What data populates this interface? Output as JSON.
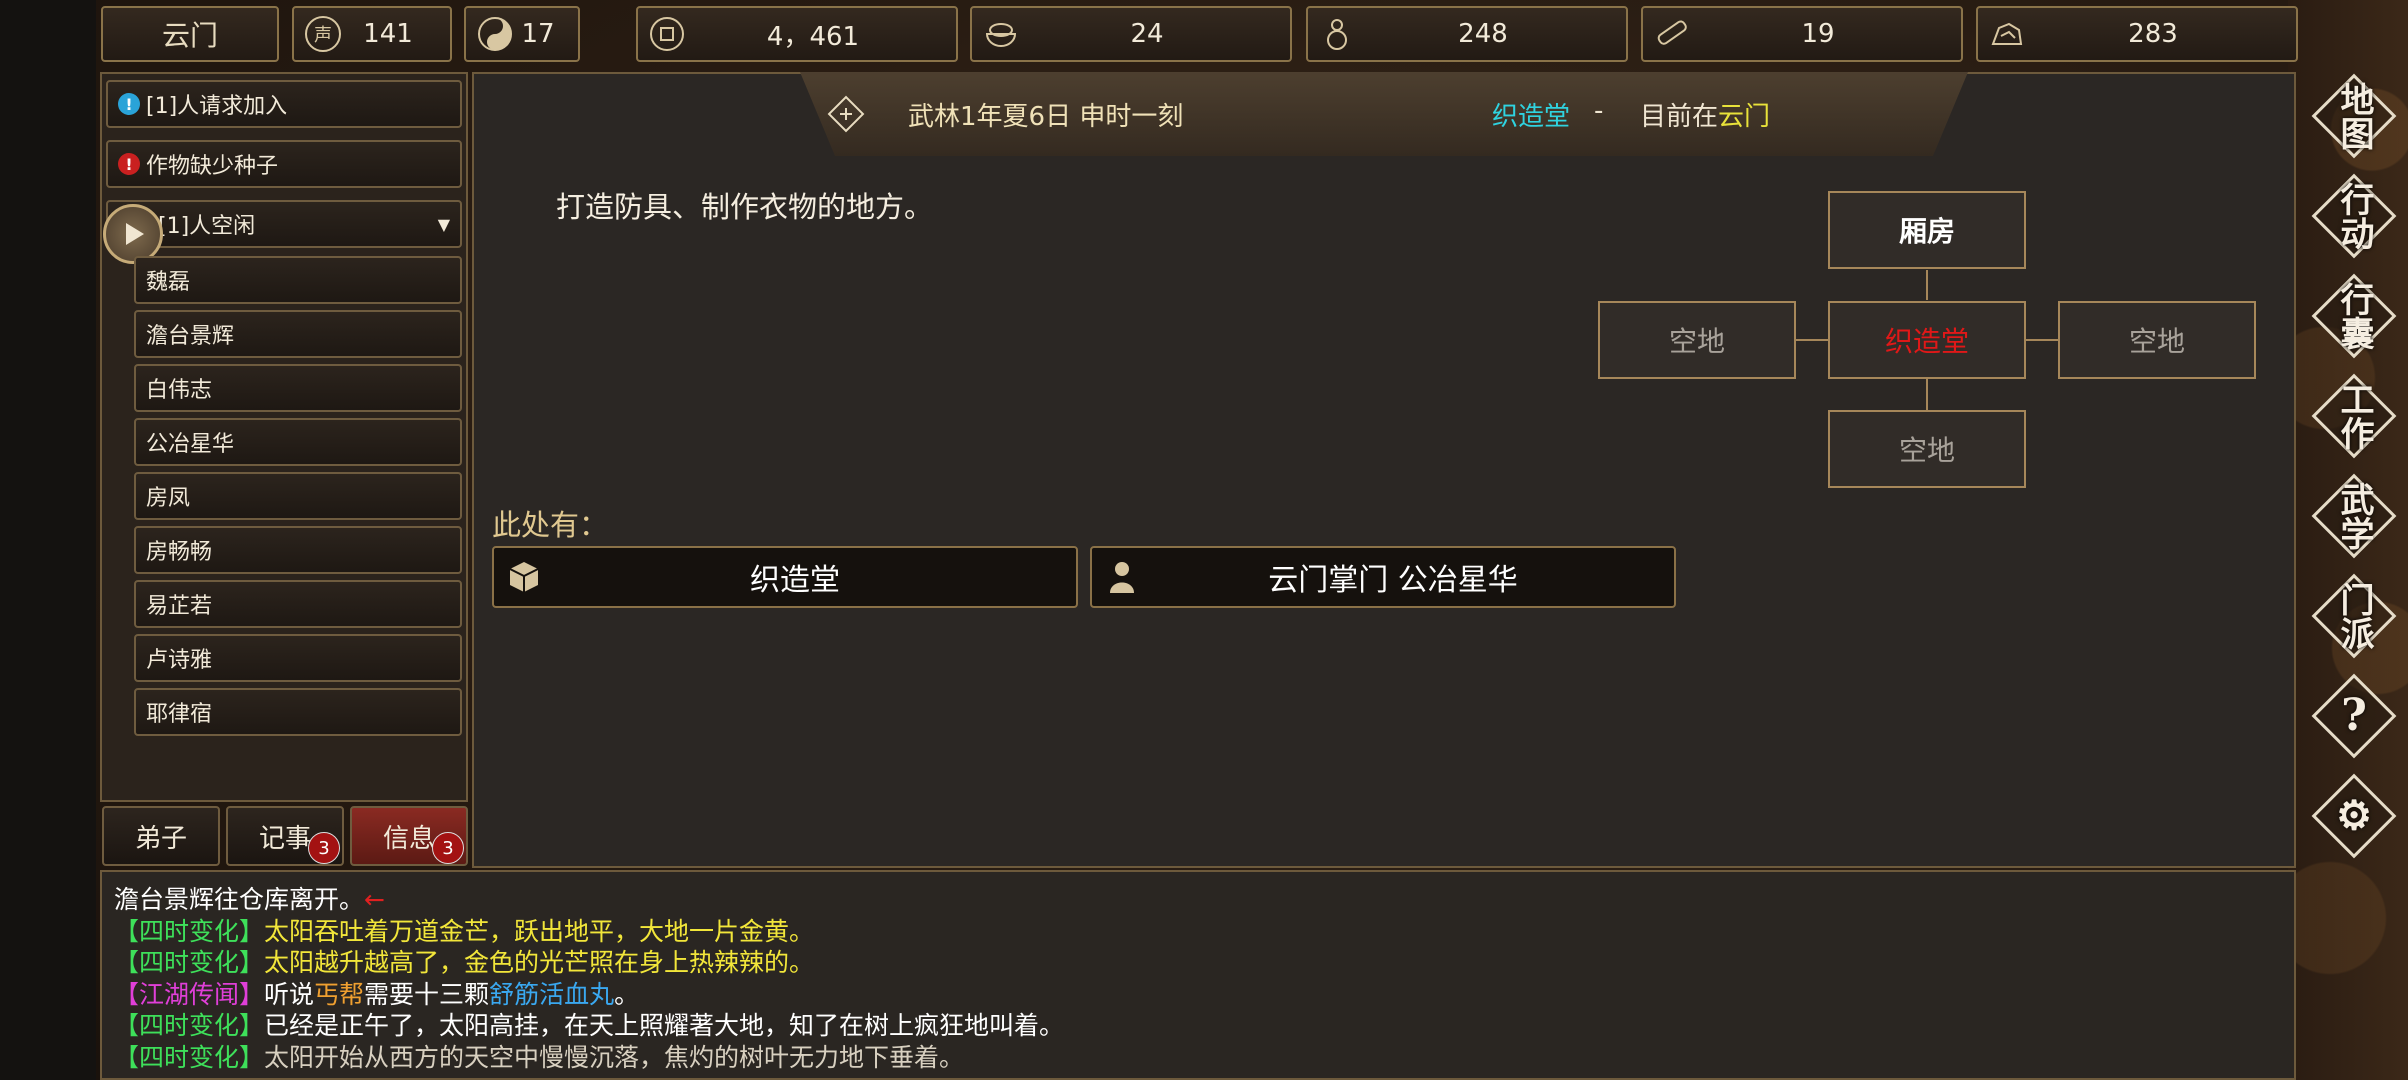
{
  "topbar": {
    "location": "云门",
    "resources": [
      {
        "icon": "reputation-icon",
        "value": "141"
      },
      {
        "icon": "yinyang-icon",
        "value": "17"
      },
      {
        "icon": "coin-icon",
        "value": "4，461"
      },
      {
        "icon": "food-bowl-icon",
        "value": "24"
      },
      {
        "icon": "gourd-icon",
        "value": "248"
      },
      {
        "icon": "wood-log-icon",
        "value": "19"
      },
      {
        "icon": "ore-icon",
        "value": "283"
      }
    ]
  },
  "left_panel": {
    "alerts": [
      {
        "label": "[1]人请求加入",
        "color": "#2aa3d8",
        "symbol": "!"
      },
      {
        "label": "作物缺少种子",
        "color": "#c92020",
        "symbol": "!"
      }
    ],
    "idle_header": "[1]人空闲",
    "disciples": [
      "魏磊",
      "澹台景辉",
      "白伟志",
      "公冶星华",
      "房凤",
      "房畅畅",
      "易芷若",
      "卢诗雅",
      "耶律宿"
    ],
    "tabs": [
      {
        "label": "弟子",
        "badge": ""
      },
      {
        "label": "记事",
        "badge": "3"
      },
      {
        "label": "信息",
        "badge": "3"
      }
    ]
  },
  "header": {
    "date": "武林1年夏6日 申时一刻",
    "building": "织造堂",
    "separator": "-",
    "location_prefix": "目前在",
    "location": "云门"
  },
  "main": {
    "description": "打造防具、制作衣物的地方。",
    "here_label": "此处有：",
    "items": [
      {
        "icon": "box-icon",
        "label": "织造堂"
      },
      {
        "icon": "person-icon",
        "label": "云门掌门 公冶星华"
      }
    ]
  },
  "map": {
    "north": "厢房",
    "west": "空地",
    "center": "织造堂",
    "east": "空地",
    "south": "空地"
  },
  "log": [
    {
      "parts": [
        {
          "t": "澹台景辉往仓库离开。",
          "c": "#ffffff"
        },
        {
          "t": "←",
          "c": "#e02020"
        }
      ]
    },
    {
      "parts": [
        {
          "t": "【四时变化】",
          "c": "#3ee05a"
        },
        {
          "t": "太阳吞吐着万道金芒，跃出地平，大地一片金黄。",
          "c": "#f2e63a"
        }
      ]
    },
    {
      "parts": [
        {
          "t": "【四时变化】",
          "c": "#3ee05a"
        },
        {
          "t": "太阳越升越高了，金色的光芒照在身上热辣辣的。",
          "c": "#f2e63a"
        }
      ]
    },
    {
      "parts": [
        {
          "t": "【江湖传闻】",
          "c": "#e03fd8"
        },
        {
          "t": "听说",
          "c": "#ffffff"
        },
        {
          "t": "丐帮",
          "c": "#f0a030"
        },
        {
          "t": "需要十三颗",
          "c": "#ffffff"
        },
        {
          "t": "舒筋活血丸",
          "c": "#3aa8f0"
        },
        {
          "t": "。",
          "c": "#ffffff"
        }
      ]
    },
    {
      "parts": [
        {
          "t": "【四时变化】",
          "c": "#3ee05a"
        },
        {
          "t": "已经是正午了，太阳高挂，在天上照耀著大地，知了在树上疯狂地叫着。",
          "c": "#ffffff"
        }
      ]
    },
    {
      "parts": [
        {
          "t": "【四时变化】",
          "c": "#3ee05a"
        },
        {
          "t": "太阳开始从西方的天空中慢慢沉落，焦灼的树叶无力地下垂着。",
          "c": "#d8d0c0"
        }
      ]
    }
  ],
  "side_menu": [
    "地图",
    "行动",
    "行囊",
    "工作",
    "武学",
    "门派",
    "?",
    "⚙"
  ],
  "colors": {
    "accent_gold": "#e8e23a",
    "accent_cyan": "#2fd3e0",
    "center_red": "#e01818"
  }
}
